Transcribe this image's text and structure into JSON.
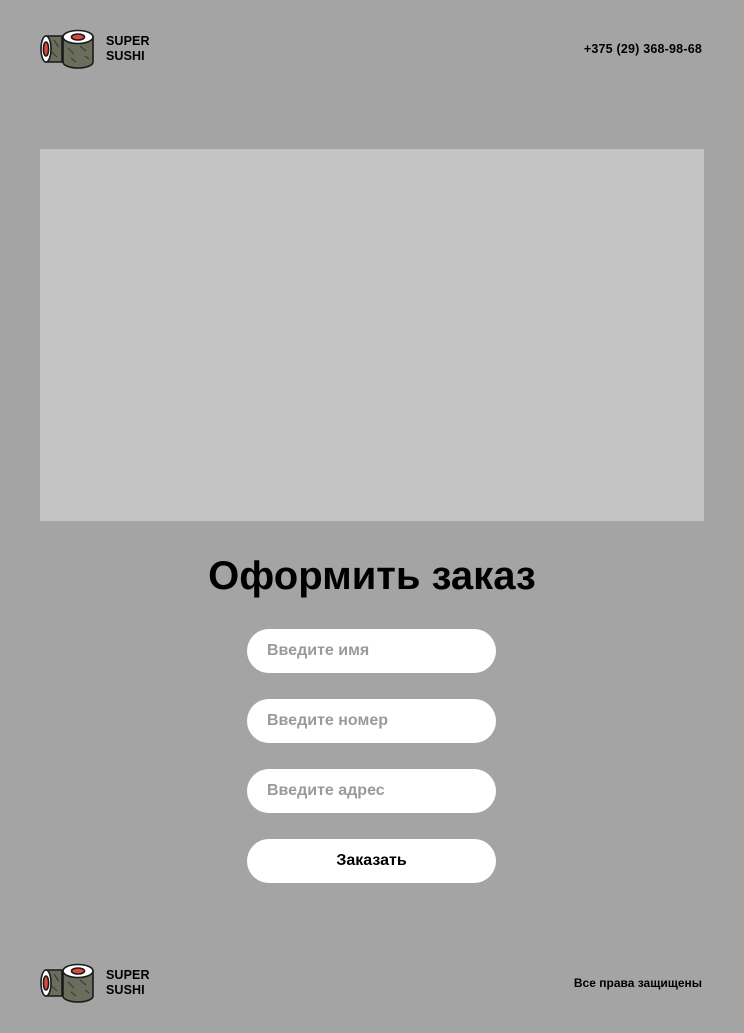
{
  "header": {
    "brand_line1": "SUPER",
    "brand_line2": "SUSHI",
    "phone": "+375 (29) 368-98-68",
    "logo_icon": "sushi-roll-icon"
  },
  "hero": {
    "placeholder_color": "#c4c4c4"
  },
  "order": {
    "title": "Оформить заказ",
    "name_placeholder": "Введите имя",
    "phone_placeholder": "Введите номер",
    "address_placeholder": "Введите адрес",
    "submit_label": "Заказать"
  },
  "footer": {
    "brand_line1": "SUPER",
    "brand_line2": "SUSHI",
    "rights": "Все права защищены",
    "logo_icon": "sushi-roll-icon"
  },
  "colors": {
    "background": "#a4a4a4",
    "hero": "#c4c4c4",
    "input": "#ffffff",
    "text": "#000000",
    "placeholder": "#9a9a9a",
    "sushi_red": "#e0463e",
    "sushi_nori": "#6b6e5c"
  }
}
